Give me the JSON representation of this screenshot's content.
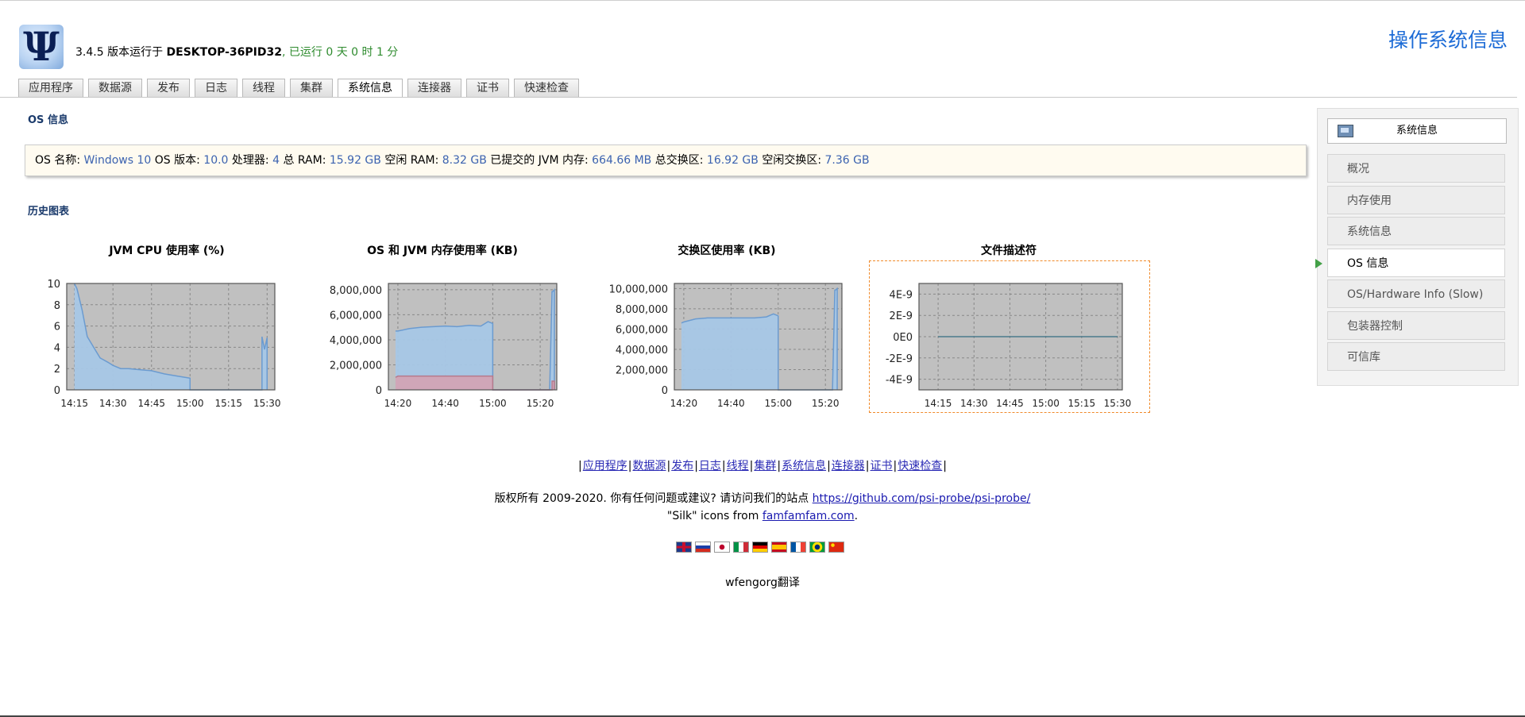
{
  "header": {
    "logo_glyph": "Ψ",
    "version_prefix": "3.4.5 版本运行于 ",
    "host": "DESKTOP-36PID32",
    "uptime": ", 已运行 0 天 0 时 1 分",
    "page_title": "操作系统信息"
  },
  "tabs": [
    "应用程序",
    "数据源",
    "发布",
    "日志",
    "线程",
    "集群",
    "系统信息",
    "连接器",
    "证书",
    "快速检查"
  ],
  "active_tab": "系统信息",
  "os_section": {
    "title": "OS 信息",
    "items": [
      {
        "label": "OS 名称: ",
        "value": "Windows 10"
      },
      {
        "label": " OS 版本: ",
        "value": "10.0"
      },
      {
        "label": " 处理器: ",
        "value": "4"
      },
      {
        "label": " 总 RAM: ",
        "value": "15.92 GB"
      },
      {
        "label": " 空闲 RAM: ",
        "value": "8.32 GB"
      },
      {
        "label": " 已提交的 JVM 内存: ",
        "value": "664.66 MB"
      },
      {
        "label": " 总交换区: ",
        "value": "16.92 GB"
      },
      {
        "label": " 空闲交换区: ",
        "value": "7.36 GB"
      }
    ]
  },
  "history_title": "历史图表",
  "colors": {
    "plot_bg": "#c0c0c0",
    "fill_blue": "#a7c7e6",
    "line_blue": "#6b9bd0",
    "fill_red": "#d7a0b0",
    "fd_border": "#f08a2a",
    "link": "#2a2ab5"
  },
  "chart_data": [
    {
      "type": "area",
      "title": "JVM CPU 使用率 (%)",
      "x_ticks": [
        "14:15",
        "14:30",
        "14:45",
        "15:00",
        "15:15",
        "15:30"
      ],
      "y_ticks": [
        "10",
        "8",
        "6",
        "4",
        "2",
        "0"
      ],
      "ylim": [
        0,
        10
      ],
      "xlim": [
        "14:12",
        "15:33"
      ],
      "grid": true,
      "series": [
        {
          "x": [
            "14:15",
            "14:16",
            "14:18",
            "14:20",
            "14:22",
            "14:25",
            "14:28",
            "14:30",
            "14:33",
            "14:36",
            "14:40",
            "14:45",
            "14:50",
            "14:55",
            "15:00",
            "15:00",
            "15:28",
            "15:28",
            "15:29",
            "15:30",
            "15:30"
          ],
          "values": [
            10,
            9.5,
            7.5,
            5,
            4.2,
            3,
            2.6,
            2.3,
            2,
            2,
            1.9,
            1.8,
            1.5,
            1.3,
            1.1,
            0,
            0,
            5,
            3.8,
            4.9,
            0
          ]
        }
      ]
    },
    {
      "type": "area",
      "title": "OS 和 JVM 内存使用率 (KB)",
      "x_ticks": [
        "14:20",
        "14:40",
        "15:00",
        "15:20"
      ],
      "y_ticks": [
        "8,000,000",
        "6,000,000",
        "4,000,000",
        "2,000,000",
        "0"
      ],
      "ylim": [
        0,
        8500000
      ],
      "xlim": [
        "14:16",
        "15:27"
      ],
      "grid": true,
      "series": [
        {
          "x": [
            "14:19",
            "14:20",
            "14:25",
            "14:30",
            "14:35",
            "14:40",
            "14:45",
            "14:50",
            "14:55",
            "14:58",
            "15:00",
            "15:00",
            "15:24",
            "15:25",
            "15:25",
            "15:26",
            "15:26"
          ],
          "values": [
            4700000,
            4700000,
            4900000,
            5000000,
            5050000,
            5100000,
            5050000,
            5150000,
            5100000,
            5450000,
            5300000,
            0,
            0,
            7900000,
            7800000,
            8000000,
            0
          ]
        },
        {
          "x": [
            "14:19",
            "14:20",
            "14:40",
            "15:00",
            "15:00",
            "15:25",
            "15:25",
            "15:26",
            "15:26"
          ],
          "values": [
            1000000,
            1100000,
            1100000,
            1100000,
            0,
            0,
            700000,
            700000,
            0
          ]
        }
      ]
    },
    {
      "type": "area",
      "title": "交换区使用率 (KB)",
      "x_ticks": [
        "14:20",
        "14:40",
        "15:00",
        "15:20"
      ],
      "y_ticks": [
        "10,000,000",
        "8,000,000",
        "6,000,000",
        "4,000,000",
        "2,000,000",
        "0"
      ],
      "ylim": [
        0,
        10500000
      ],
      "xlim": [
        "14:16",
        "15:27"
      ],
      "grid": true,
      "series": [
        {
          "x": [
            "14:19",
            "14:20",
            "14:25",
            "14:30",
            "14:35",
            "14:40",
            "14:45",
            "14:50",
            "14:55",
            "14:58",
            "15:00",
            "15:00",
            "15:23",
            "15:24",
            "15:24",
            "15:25",
            "15:25"
          ],
          "values": [
            6600000,
            6700000,
            7000000,
            7100000,
            7100000,
            7100000,
            7100000,
            7100000,
            7200000,
            7500000,
            7300000,
            0,
            0,
            9900000,
            9800000,
            10000000,
            0
          ]
        }
      ]
    },
    {
      "type": "line",
      "title": "文件描述符",
      "x_ticks": [
        "14:15",
        "14:30",
        "14:45",
        "15:00",
        "15:15",
        "15:30"
      ],
      "y_ticks": [
        "4E-9",
        "2E-9",
        "0E0",
        "-2E-9",
        "-4E-9"
      ],
      "ylim": [
        -5e-09,
        5e-09
      ],
      "xlim": [
        "14:07",
        "15:32"
      ],
      "grid": true,
      "series": [
        {
          "x": [
            "14:15",
            "15:30"
          ],
          "values": [
            0,
            0
          ]
        }
      ]
    }
  ],
  "footer": {
    "links": [
      "应用程序",
      "数据源",
      "发布",
      "日志",
      "线程",
      "集群",
      "系统信息",
      "连接器",
      "证书",
      "快速检查"
    ],
    "copyright_text": "版权所有 2009-2020. 你有任何问题或建议? 请访问我们的站点 ",
    "copyright_link": "https://github.com/psi-probe/psi-probe/",
    "silk_prefix": "\"Silk\" icons from ",
    "silk_link": "famfamfam.com",
    "silk_suffix": ".",
    "flags": [
      "uk-flag-icon",
      "russia-flag-icon",
      "japan-flag-icon",
      "italy-flag-icon",
      "germany-flag-icon",
      "spain-flag-icon",
      "france-flag-icon",
      "brazil-flag-icon",
      "china-flag-icon"
    ],
    "translator": "wfengorg翻译"
  },
  "right_panel": {
    "header": "系统信息",
    "items": [
      "概况",
      "内存使用",
      "系统信息",
      "OS 信息",
      "OS/Hardware Info (Slow)",
      "包装器控制",
      "可信库"
    ],
    "active": "OS 信息"
  }
}
